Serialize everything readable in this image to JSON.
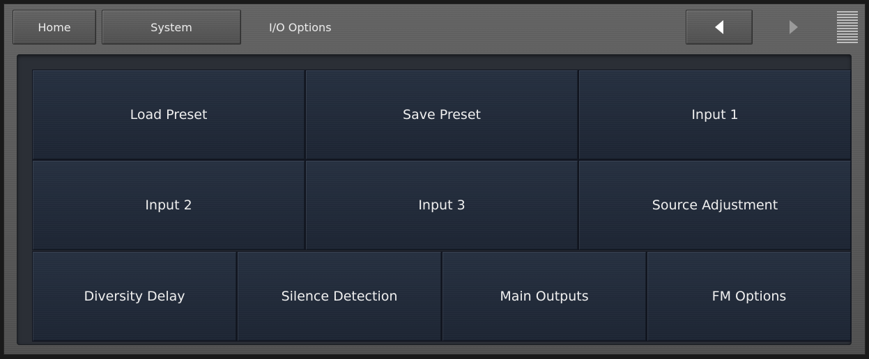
{
  "header": {
    "home_label": "Home",
    "system_label": "System",
    "page_label": "I/O Options"
  },
  "nav": {
    "back_icon": "triangle-left-icon",
    "forward_icon": "triangle-right-icon",
    "menu_icon": "menu-lines-icon"
  },
  "buttons": {
    "row1": [
      "Load Preset",
      "Save Preset",
      "Input 1"
    ],
    "row2": [
      "Input 2",
      "Input 3",
      "Source Adjustment"
    ],
    "row3": [
      "Diversity Delay",
      "Silence Detection",
      "Main Outputs",
      "FM Options"
    ]
  },
  "colors": {
    "button_bg": "#222b39",
    "button_text": "#f0f0f0",
    "chrome": "#505050"
  }
}
